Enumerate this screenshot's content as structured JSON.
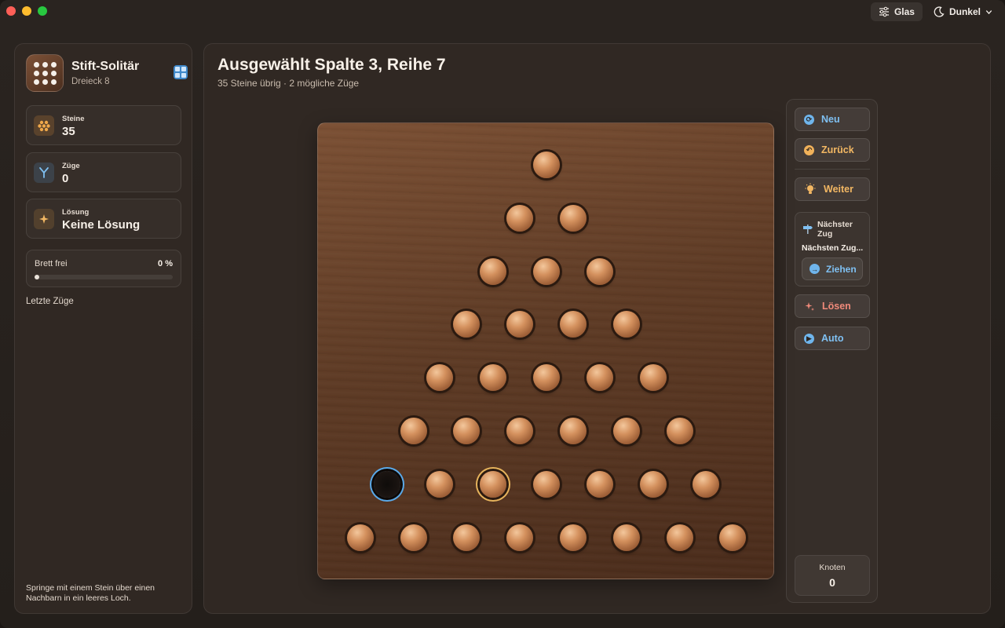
{
  "toolbar": {
    "glass_label": "Glas",
    "theme_label": "Dunkel",
    "icons": [
      "sliders-icon",
      "moon-icon",
      "chevron-down-icon"
    ]
  },
  "sidebar": {
    "app_title": "Stift-Solitär",
    "app_subtitle": "Dreieck 8",
    "stats": [
      {
        "label": "Steine",
        "value": "35",
        "icon": "pegs-icon"
      },
      {
        "label": "Züge",
        "value": "0",
        "icon": "fork-icon"
      },
      {
        "label": "Lösung",
        "value": "Keine Lösung",
        "icon": "sparkle-icon"
      }
    ],
    "progress": {
      "label": "Brett frei",
      "percent_text": "0 %",
      "fraction": 0.0
    },
    "recent_moves_label": "Letzte Züge",
    "hint": "Springe mit einem Stein über einen Nachbarn in ein leeres Loch."
  },
  "main": {
    "title": "Ausgewählt Spalte 3, Reihe 7",
    "subtitle": "35 Steine übrig · 2 mögliche Züge"
  },
  "board": {
    "rows": 8,
    "empty": {
      "row": 7,
      "col": 1
    },
    "selected": {
      "row": 7,
      "col": 3
    }
  },
  "controls": {
    "new_label": "Neu",
    "undo_label": "Zurück",
    "hint_label": "Weiter",
    "next_move_title": "Nächster Zug",
    "next_move_desc": "Nächsten Zug...",
    "apply_label": "Ziehen",
    "solve_label": "Lösen",
    "auto_label": "Auto",
    "nodes_label": "Knoten",
    "nodes_value": "0"
  },
  "colors": {
    "accent_blue": "#6fb5ec",
    "accent_orange": "#f0b15a",
    "accent_red": "#f08a7a",
    "selection_ring": "#e6b35c",
    "empty_ring": "#5aa9e8"
  }
}
